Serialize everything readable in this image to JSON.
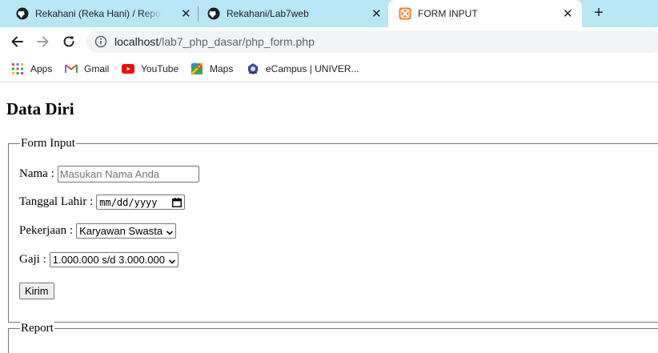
{
  "tabs": [
    {
      "title": "Rekahani (Reka Hani) / Repositories",
      "icon": "github-icon",
      "close": "✕"
    },
    {
      "title": "Rekahani/Lab7web",
      "icon": "github-icon",
      "close": "✕"
    },
    {
      "title": "FORM INPUT",
      "icon": "xampp-icon",
      "close": "✕"
    }
  ],
  "new_tab": "+",
  "address": {
    "host": "localhost",
    "path": "/lab7_php_dasar/php_form.php"
  },
  "bookmarks": [
    {
      "label": "Apps",
      "icon": "apps-grid-icon"
    },
    {
      "label": "Gmail",
      "icon": "gmail-icon"
    },
    {
      "label": "YouTube",
      "icon": "youtube-icon"
    },
    {
      "label": "Maps",
      "icon": "maps-icon"
    },
    {
      "label": "eCampus | UNIVER...",
      "icon": "ecampus-icon"
    }
  ],
  "page": {
    "title": "Data Diri",
    "form": {
      "legend": "Form Input",
      "nama_label": "Nama :",
      "nama_placeholder": "Masukan Nama Anda",
      "tanggal_label": "Tanggal Lahir :",
      "tanggal_value": "mm/dd/yyyy",
      "pekerjaan_label": "Pekerjaan :",
      "pekerjaan_value": "Karyawan Swasta",
      "gaji_label": "Gaji :",
      "gaji_value": "1.000.000 s/d 3.000.000",
      "submit_label": "Kirim"
    },
    "report_legend": "Report"
  },
  "colors": {
    "tabstrip": "#b9e6f5",
    "active_tab": "#ffffff",
    "omnibox": "#f1f3f4"
  }
}
